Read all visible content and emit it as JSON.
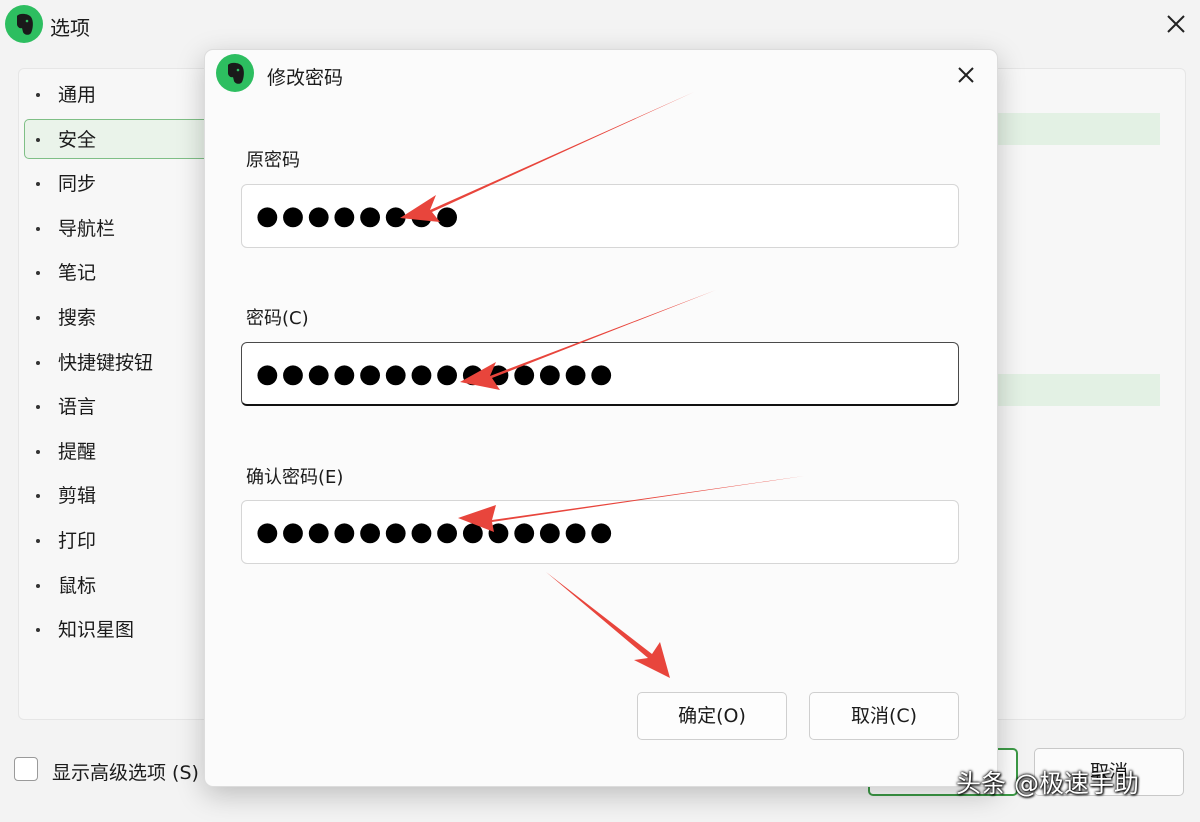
{
  "window": {
    "title": "选项",
    "app_icon": "evernote-elephant-icon"
  },
  "sidebar": {
    "items": [
      {
        "label": "通用",
        "active": false
      },
      {
        "label": "安全",
        "active": true
      },
      {
        "label": "同步",
        "active": false
      },
      {
        "label": "导航栏",
        "active": false
      },
      {
        "label": "笔记",
        "active": false
      },
      {
        "label": "搜索",
        "active": false
      },
      {
        "label": "快捷键按钮",
        "active": false
      },
      {
        "label": "语言",
        "active": false
      },
      {
        "label": "提醒",
        "active": false
      },
      {
        "label": "剪辑",
        "active": false
      },
      {
        "label": "打印",
        "active": false
      },
      {
        "label": "鼠标",
        "active": false
      },
      {
        "label": "知识星图",
        "active": false
      }
    ]
  },
  "footer": {
    "advanced_label": "显示高级选项 (S)",
    "cancel_partial": "取消"
  },
  "dialog": {
    "title": "修改密码",
    "fields": {
      "old_password": {
        "label": "原密码",
        "value": "●●●●●●●●"
      },
      "new_password": {
        "label": "密码(C)",
        "value": "●●●●●●●●●●●●●●"
      },
      "confirm_password": {
        "label": "确认密码(E)",
        "value": "●●●●●●●●●●●●●●"
      }
    },
    "ok_label": "确定(O)",
    "cancel_label": "取消(C)"
  },
  "watermark": "头条 @极速手助",
  "colors": {
    "brand_green": "#2dbe60",
    "accent_green": "#3c9a46",
    "annotation_red": "#e8453c"
  }
}
